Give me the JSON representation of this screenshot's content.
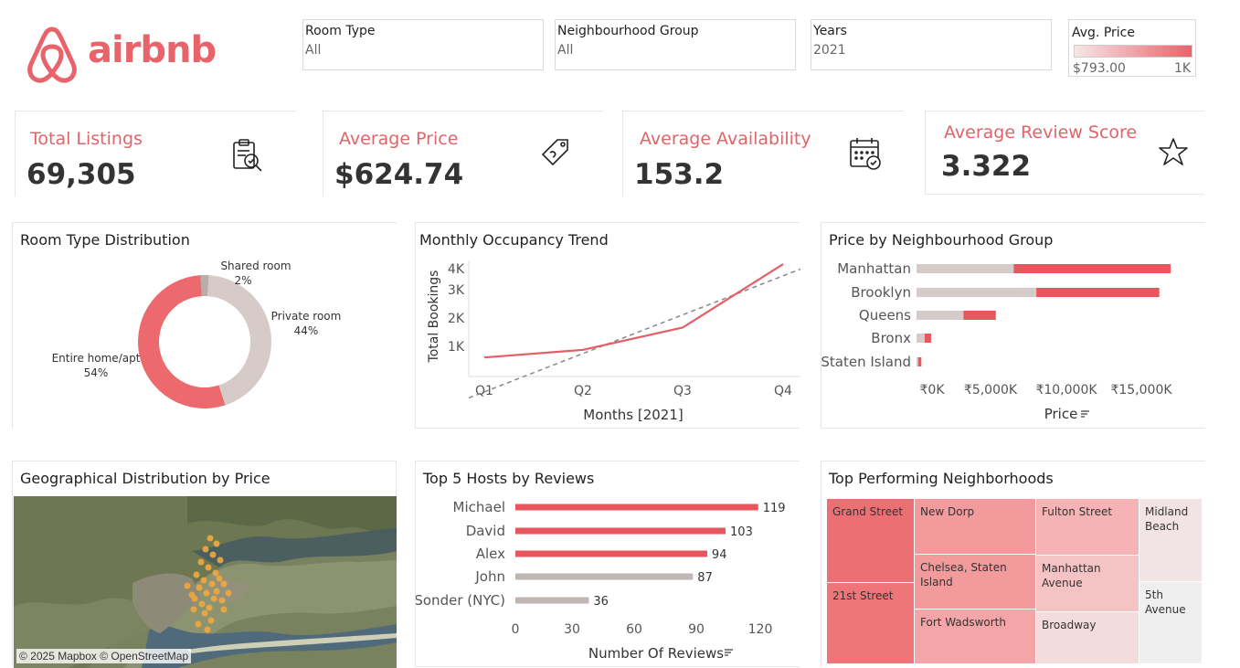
{
  "header": {
    "logo_text": "airbnb",
    "filters": [
      {
        "label": "Room Type",
        "value": "All"
      },
      {
        "label": "Neighbourhood Group",
        "value": "All"
      },
      {
        "label": "Years",
        "value": "2021"
      }
    ],
    "price_legend": {
      "label": "Avg. Price",
      "min": "$793.00",
      "max": "1K",
      "color_low": "#f7e6e6",
      "color_high": "#e9626a"
    }
  },
  "kpis": [
    {
      "title": "Total Listings",
      "value": "69,305",
      "icon": "clipboard-check-icon"
    },
    {
      "title": "Average Price",
      "value": "$624.74",
      "icon": "price-tag-icon"
    },
    {
      "title": "Average Availability",
      "value": "153.2",
      "icon": "calendar-check-icon"
    },
    {
      "title": "Average Review Score",
      "value": "3.322",
      "icon": "star-outline-icon"
    }
  ],
  "room_type": {
    "title": "Room Type Distribution",
    "slices": [
      {
        "name": "Entire home/apt",
        "pct_label": "54%",
        "value": 54,
        "color": "#ec6a6d"
      },
      {
        "name": "Private room",
        "pct_label": "44%",
        "value": 44,
        "color": "#d7cbc9"
      },
      {
        "name": "Shared room",
        "pct_label": "2%",
        "value": 2,
        "color": "#b9adab"
      }
    ]
  },
  "occupancy": {
    "title": "Monthly Occupancy Trend",
    "xlabel": "Months [2021]",
    "ylabel": "Total Bookings",
    "x_ticks": [
      "Q1",
      "Q2",
      "Q3",
      "Q4"
    ],
    "y_ticks": [
      "1K",
      "2K",
      "3K",
      "4K"
    ]
  },
  "price_by_group": {
    "title": "Price by  Neighbourhood Group",
    "xlabel": "Price",
    "x_ticks": [
      "₹0K",
      "₹5,000K",
      "₹10,000K",
      "₹15,000K"
    ]
  },
  "geo": {
    "title": "Geographical Distribution by Price",
    "attribution": "© 2025 Mapbox © OpenStreetMap"
  },
  "top_hosts": {
    "title": "Top 5 Hosts by Reviews",
    "xlabel": "Number Of Reviews",
    "x_ticks": [
      "0",
      "30",
      "60",
      "90",
      "120"
    ]
  },
  "top_neighborhoods": {
    "title": "Top Performing Neighborhoods",
    "cells": [
      "Grand Street",
      "21st Street",
      "New Dorp",
      "Chelsea, Staten Island",
      "Fort Wadsworth",
      "Fulton Street",
      "Manhattan Avenue",
      "Broadway",
      "Midland Beach",
      "5th Avenue"
    ]
  },
  "chart_data": [
    {
      "type": "pie",
      "title": "Room Type Distribution",
      "categories": [
        "Entire home/apt",
        "Private room",
        "Shared room"
      ],
      "values": [
        54,
        44,
        2
      ]
    },
    {
      "type": "line",
      "title": "Monthly Occupancy Trend",
      "xlabel": "Months [2021]",
      "ylabel": "Total Bookings",
      "x": [
        "Q1",
        "Q2",
        "Q3",
        "Q4"
      ],
      "series": [
        {
          "values": [
            370,
            680,
            1580,
            4150
          ]
        }
      ],
      "trend_line": {
        "start": -230,
        "end": 3950
      },
      "ylim": [
        -400,
        4300
      ]
    },
    {
      "type": "bar",
      "title": "Price by  Neighbourhood Group",
      "xlabel": "Price",
      "categories": [
        "Manhattan",
        "Brooklyn",
        "Queens",
        "Bronx",
        "Staten Island"
      ],
      "series": [
        {
          "values": [
            6000,
            7400,
            2900,
            500,
            100
          ]
        },
        {
          "values": [
            9700,
            7600,
            2000,
            400,
            200
          ]
        }
      ],
      "xlim": [
        0,
        17500
      ]
    },
    {
      "type": "bar",
      "title": "Top 5 Hosts by Reviews",
      "xlabel": "Number Of Reviews",
      "categories": [
        "Michael",
        "David",
        "Alex",
        "John",
        "Sonder (NYC)"
      ],
      "values": [
        119,
        103,
        94,
        87,
        36
      ],
      "xlim": [
        0,
        130
      ]
    }
  ]
}
